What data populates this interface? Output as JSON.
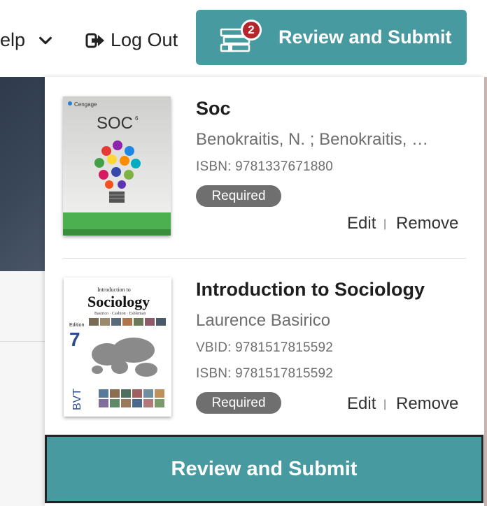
{
  "header": {
    "help_label": "elp",
    "logout_label": "Log Out",
    "review_label": "Review and Submit",
    "cart_count": "2"
  },
  "books": [
    {
      "title": "Soc",
      "author": "Benokraitis, N. ; Benokraitis, …",
      "isbn": "ISBN: 9781337671880",
      "tag": "Required",
      "edit": "Edit",
      "remove": "Remove",
      "cover": {
        "brand": "Cengage",
        "title": "SOC",
        "edition": "6"
      }
    },
    {
      "title": "Introduction to Sociology",
      "author": "Laurence Basirico",
      "vbid": "VBID: 9781517815592",
      "isbn": "ISBN: 9781517815592",
      "tag": "Required",
      "edit": "Edit",
      "remove": "Remove",
      "cover": {
        "small_title": "Introduction to",
        "big_title": "Sociology",
        "authors": "Basirico · Cashion · Eshleman",
        "edition_label": "Edition",
        "edition": "7",
        "publisher": "BVT"
      }
    }
  ],
  "footer": {
    "review_label": "Review and Submit"
  },
  "colors": {
    "accent": "#479aa0",
    "badge": "#b3262b",
    "pill": "#6f6f6f"
  }
}
